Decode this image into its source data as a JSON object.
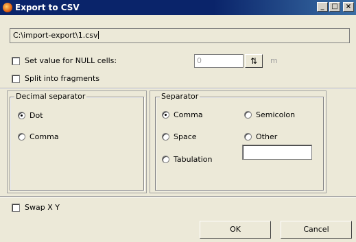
{
  "window": {
    "title": "Export to CSV",
    "minimize_glyph": "_",
    "maximize_glyph": "□",
    "close_glyph": "×"
  },
  "file": {
    "path": "C:\\import-export\\1.csv"
  },
  "null_cells": {
    "label": "Set value for NULL cells:",
    "checked": false,
    "value": "0",
    "unit": "m",
    "spin_glyph": "⇅"
  },
  "split": {
    "label": "Split into fragments",
    "checked": false
  },
  "decimal_separator": {
    "title": "Decimal separator",
    "options": [
      {
        "label": "Dot",
        "selected": true
      },
      {
        "label": "Comma",
        "selected": false
      }
    ]
  },
  "separator": {
    "title": "Separator",
    "options": [
      {
        "label": "Comma",
        "selected": true
      },
      {
        "label": "Semicolon",
        "selected": false
      },
      {
        "label": "Space",
        "selected": false
      },
      {
        "label": "Other",
        "selected": false
      },
      {
        "label": "Tabulation",
        "selected": false
      }
    ],
    "other_value": ""
  },
  "swap": {
    "label": "Swap X Y",
    "checked": false
  },
  "buttons": {
    "ok": "OK",
    "cancel": "Cancel"
  }
}
